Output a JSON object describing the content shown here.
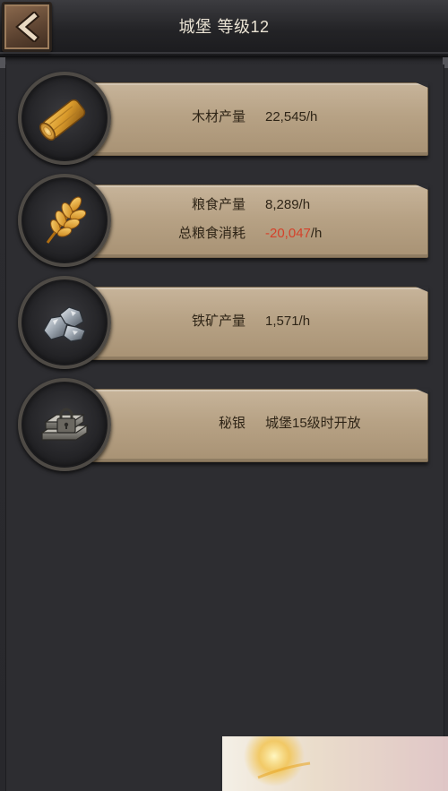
{
  "header": {
    "title_name": "城堡",
    "title_level": "等级12",
    "back_icon": "chevron-left-icon"
  },
  "resources": [
    {
      "icon": "wood-log-icon",
      "stats": [
        {
          "label": "木材产量",
          "value": "22,545/h"
        }
      ]
    },
    {
      "icon": "wheat-icon",
      "stats": [
        {
          "label": "粮食产量",
          "value": "8,289/h"
        },
        {
          "label": "总粮食消耗",
          "value_neg": "-20,047",
          "value_unit": "/h"
        }
      ]
    },
    {
      "icon": "iron-ore-icon",
      "stats": [
        {
          "label": "铁矿产量",
          "value": "1,571/h"
        }
      ]
    },
    {
      "icon": "locked-silver-ingot-icon",
      "stats": [
        {
          "label": "秘银",
          "value": "城堡15级时开放"
        }
      ]
    }
  ],
  "colors": {
    "plate": "#b7a285",
    "negative": "#d5412a",
    "text": "#2f2517",
    "title": "#eae3d4"
  }
}
